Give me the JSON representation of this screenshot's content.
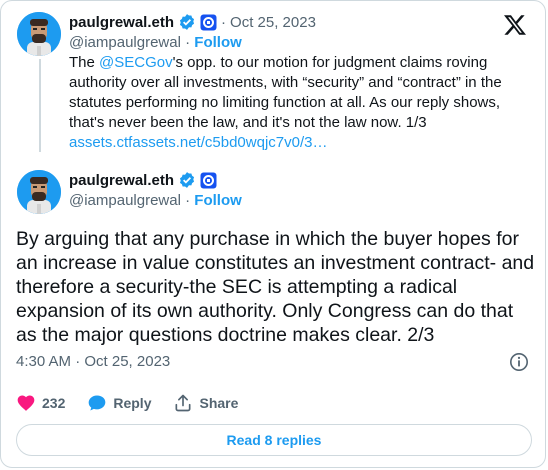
{
  "tweet1": {
    "display_name": "paulgrewal.eth",
    "separator": "·",
    "date": "Oct 25, 2023",
    "handle": "@iampaulgrewal",
    "handle_sep": "·",
    "follow_label": "Follow",
    "text_prefix": "The ",
    "mention": "@SECGov",
    "text_rest": "'s opp. to our motion for judgment claims roving authority over all investments, with “security” and “contract” in the statutes performing no limiting function at all. As our reply shows, that's never been the law, and it's not the law now. 1/3",
    "link": "assets.ctfassets.net/c5bd0wqjc7v0/3…"
  },
  "tweet2": {
    "display_name": "paulgrewal.eth",
    "handle": "@iampaulgrewal",
    "handle_sep": "·",
    "follow_label": "Follow",
    "text": "By arguing that any purchase in which the buyer hopes for an increase in value constitutes an investment contract- and therefore a security-the SEC is attempting a radical expansion of its own authority. Only Congress can do that as the major questions doctrine makes clear. 2/3",
    "timestamp": "4:30 AM · Oct 25, 2023"
  },
  "actions": {
    "likes_count": "232",
    "reply_label": "Reply",
    "share_label": "Share"
  },
  "read_replies_label": "Read 8 replies",
  "colors": {
    "accent": "#1d9bf0",
    "like": "#f91880",
    "muted": "#536471",
    "border": "#cfd9de"
  },
  "icons": [
    "x-logo-icon",
    "verified-badge-icon",
    "org-badge-icon",
    "info-icon",
    "heart-icon",
    "reply-bubble-icon",
    "share-icon"
  ]
}
